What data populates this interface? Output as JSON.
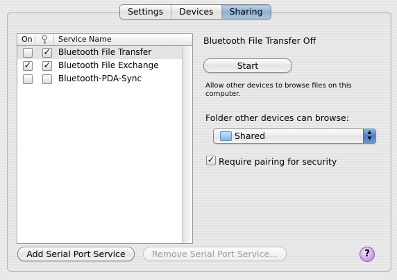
{
  "tabs": [
    {
      "label": "Settings",
      "active": false
    },
    {
      "label": "Devices",
      "active": false
    },
    {
      "label": "Sharing",
      "active": true
    }
  ],
  "services": {
    "columns": {
      "on": "On",
      "service_name": "Service Name"
    },
    "key_icon": "key-icon",
    "rows": [
      {
        "name": "Bluetooth File Transfer",
        "on": false,
        "secure": true,
        "selected": true
      },
      {
        "name": "Bluetooth File Exchange",
        "on": true,
        "secure": true,
        "selected": false
      },
      {
        "name": "Bluetooth-PDA-Sync",
        "on": false,
        "secure": false,
        "selected": false
      }
    ]
  },
  "detail": {
    "status": "Bluetooth File Transfer Off",
    "start_label": "Start",
    "description": "Allow other devices to browse files on this computer.",
    "folder_label": "Folder other devices can browse:",
    "folder_value": "Shared",
    "require_pairing_label": "Require pairing for security",
    "require_pairing_checked": true
  },
  "footer": {
    "add_label": "Add Serial Port Service",
    "remove_label": "Remove Serial Port Service...",
    "help_label": "?"
  },
  "colors": {
    "tab_active": "#9cbbdc",
    "help": "#c9a6e8"
  }
}
